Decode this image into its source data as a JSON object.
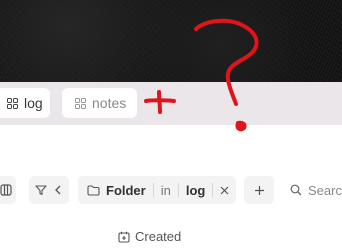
{
  "tabs": [
    {
      "label": "log",
      "icon": "grid-icon",
      "active": true
    },
    {
      "label": "notes",
      "icon": "grid-icon",
      "active": false
    }
  ],
  "annotation": {
    "plus_color": "#e0141b",
    "question_color": "#e0141b"
  },
  "toolbar": {
    "filter_chip": {
      "folder_label": "Folder",
      "operator": "in",
      "value": "log"
    },
    "search_placeholder": "Search"
  },
  "column": {
    "created_label": "Created"
  }
}
